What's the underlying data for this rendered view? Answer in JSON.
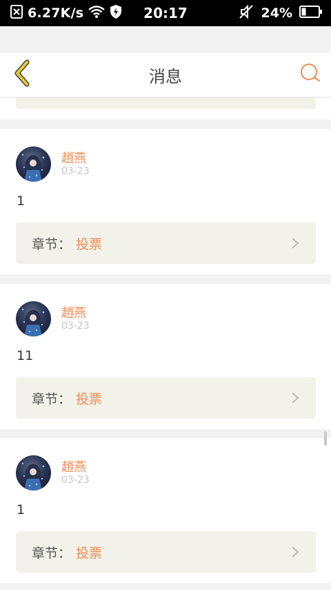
{
  "status_bar": {
    "network_speed": "6.27K/s",
    "time": "20:17",
    "battery": "24%",
    "icons": [
      "close-box-icon",
      "wifi-icon",
      "shield-icon",
      "muted-icon",
      "battery-icon"
    ]
  },
  "header": {
    "title": "消息",
    "back_icon": "chevron-left-icon",
    "search_icon": "search-icon"
  },
  "messages": [
    {
      "author": "趙燕",
      "date": "03-23",
      "text": "1",
      "chapter_label": "章节：",
      "chapter_name": "投票"
    },
    {
      "author": "趙燕",
      "date": "03-23",
      "text": "11",
      "chapter_label": "章节：",
      "chapter_name": "投票"
    },
    {
      "author": "趙燕",
      "date": "03-23",
      "text": "1",
      "chapter_label": "章节：",
      "chapter_name": "投票"
    }
  ],
  "colors": {
    "accent": "#ef8a52",
    "back_icon": "#e5c840",
    "chapter_bg": "#f3f2ea",
    "page_bg": "#f2f2f2"
  }
}
